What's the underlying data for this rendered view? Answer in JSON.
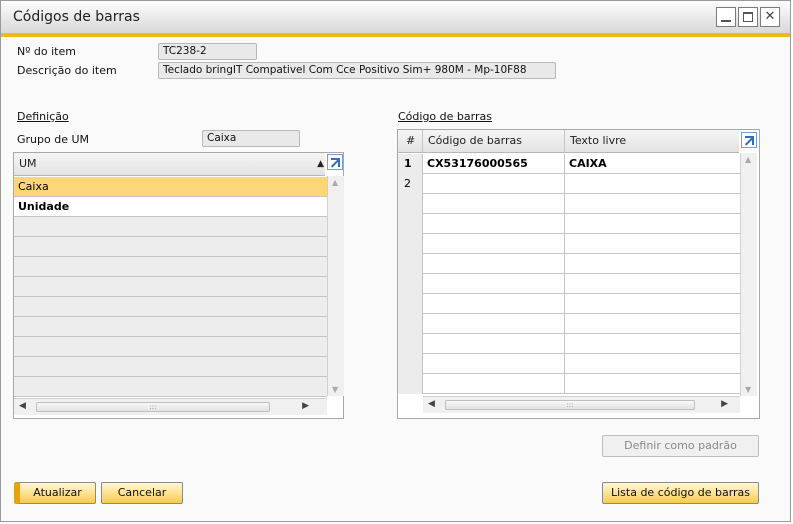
{
  "window": {
    "title": "Códigos de barras",
    "accent": "#f5b617"
  },
  "item": {
    "number_label": "Nº do item",
    "number_value": "TC238-2",
    "desc_label": "Descrição do item",
    "desc_value": "Teclado bringIT Compativel Com Cce Positivo Sim+ 980M - Mp-10F88"
  },
  "definition": {
    "heading": "Definição",
    "group_label": "Grupo de UM",
    "group_value": "Caixa",
    "column": "UM",
    "rows": [
      "Caixa",
      "Unidade"
    ],
    "selected_color": "#fbd77a"
  },
  "barcodes": {
    "heading": "Código de barras",
    "col_num": "#",
    "col_code": "Código de barras",
    "col_text": "Texto livre",
    "rows": [
      {
        "num": "1",
        "code": "CX53176000565",
        "text": "CAIXA"
      },
      {
        "num": "2",
        "code": "",
        "text": ""
      }
    ]
  },
  "buttons": {
    "update": "Atualizar",
    "cancel": "Cancelar",
    "set_default": "Definir como padrão",
    "barcode_list": "Lista de código de barras"
  }
}
